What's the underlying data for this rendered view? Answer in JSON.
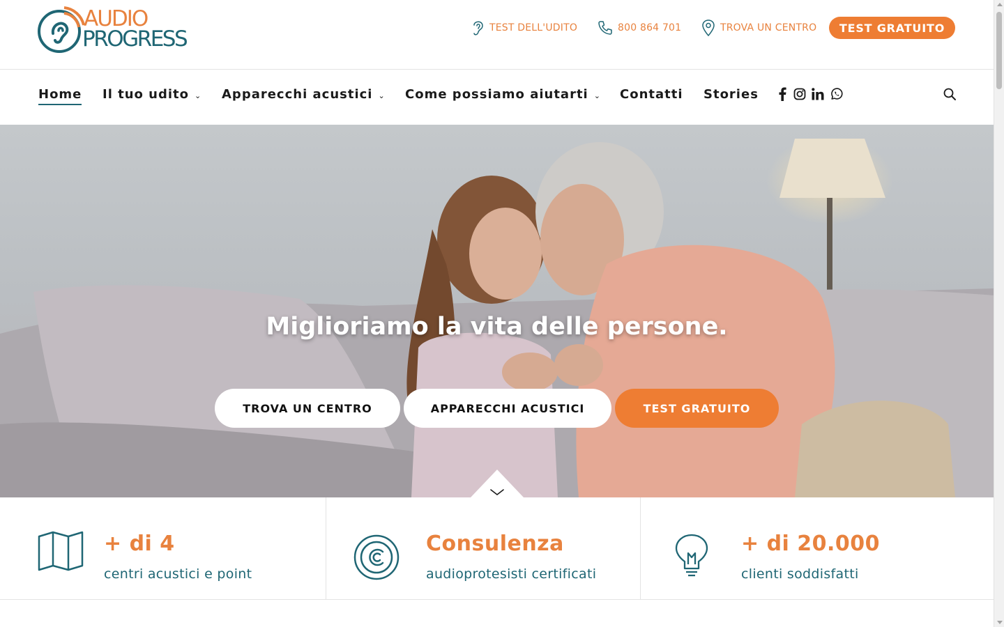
{
  "brand": {
    "logo_word_top": "AUDIO",
    "logo_word_bottom": "PROGRESS",
    "accent": "#ee7d33",
    "teal": "#1f6674"
  },
  "utility": {
    "test_label": "TEST DELL'UDITO",
    "test_icon": "ear-icon",
    "phone_label": "800 864 701",
    "phone_icon": "phone-icon",
    "center_label": "TROVA UN CENTRO",
    "center_icon": "map-pin-icon",
    "cta_label": "TEST GRATUITO"
  },
  "nav": {
    "items": [
      {
        "label": "Home",
        "active": true
      },
      {
        "label": "Il tuo udito",
        "caret": "⌄"
      },
      {
        "label": "Apparecchi acustici",
        "caret": "⌄"
      },
      {
        "label": "Come possiamo aiutarti",
        "caret": "⌄"
      },
      {
        "label": "Contatti"
      },
      {
        "label": "Stories"
      }
    ],
    "social": [
      "facebook-icon",
      "instagram-icon",
      "linkedin-icon",
      "whatsapp-icon"
    ],
    "search_icon": "search-icon"
  },
  "hero": {
    "title": "Miglioriamo la vita delle persone.",
    "buttons": [
      {
        "label": "TROVA UN CENTRO"
      },
      {
        "label": "APPARECCHI ACUSTICI"
      },
      {
        "label": "TEST GRATUITO"
      }
    ],
    "scroll_icon": "chevron-down-icon"
  },
  "stats": [
    {
      "icon": "map-icon",
      "value": "+ di 4",
      "label": "centri acustici e point"
    },
    {
      "icon": "copyright-icon",
      "value": "Consulenza",
      "label": "audioprotesisti certificati"
    },
    {
      "icon": "lightbulb-icon",
      "value": "+ di 20.000",
      "label": "clienti soddisfatti"
    }
  ]
}
